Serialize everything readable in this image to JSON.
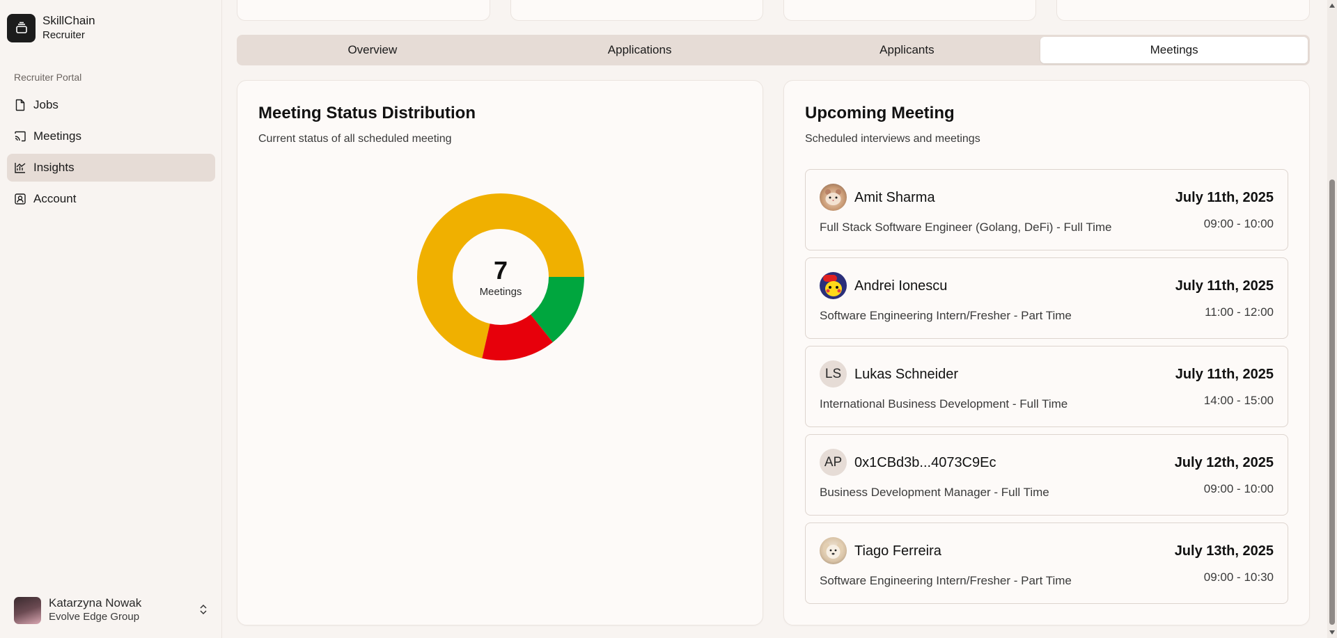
{
  "brand": {
    "name": "SkillChain",
    "subtitle": "Recruiter"
  },
  "sidebar": {
    "section_label": "Recruiter Portal",
    "items": [
      {
        "label": "Jobs",
        "icon": "document-icon"
      },
      {
        "label": "Meetings",
        "icon": "cast-icon"
      },
      {
        "label": "Insights",
        "icon": "chart-icon",
        "active": true
      },
      {
        "label": "Account",
        "icon": "user-square-icon"
      }
    ]
  },
  "user": {
    "name": "Katarzyna Nowak",
    "org": "Evolve Edge Group"
  },
  "tabs": [
    {
      "label": "Overview"
    },
    {
      "label": "Applications"
    },
    {
      "label": "Applicants"
    },
    {
      "label": "Meetings",
      "active": true
    }
  ],
  "status_card": {
    "title": "Meeting Status Distribution",
    "subtitle": "Current status of all scheduled meeting",
    "center_value": "7",
    "center_label": "Meetings"
  },
  "chart_data": {
    "type": "pie",
    "donut": true,
    "total": 7,
    "values": [
      5,
      1,
      1
    ],
    "colors": [
      "#f0b000",
      "#00a63e",
      "#e7000b"
    ]
  },
  "upcoming": {
    "title": "Upcoming Meeting",
    "subtitle": "Scheduled interviews and meetings",
    "meetings": [
      {
        "name": "Amit Sharma",
        "initials": "",
        "avatar": "hamster-photo",
        "date": "July 11th, 2025",
        "time": "09:00 - 10:00",
        "job": "Full Stack Software Engineer (Golang, DeFi) - Full Time"
      },
      {
        "name": "Andrei Ionescu",
        "initials": "",
        "avatar": "pikachu-image",
        "date": "July 11th, 2025",
        "time": "11:00 - 12:00",
        "job": "Software Engineering Intern/Fresher - Part Time"
      },
      {
        "name": "Lukas Schneider",
        "initials": "LS",
        "avatar": "",
        "date": "July 11th, 2025",
        "time": "14:00 - 15:00",
        "job": "International Business Development - Full Time"
      },
      {
        "name": "0x1CBd3b...4073C9Ec",
        "initials": "AP",
        "avatar": "",
        "date": "July 12th, 2025",
        "time": "09:00 - 10:00",
        "job": "Business Development Manager - Full Time"
      },
      {
        "name": "Tiago Ferreira",
        "initials": "",
        "avatar": "dog-photo",
        "date": "July 13th, 2025",
        "time": "09:00 - 10:30",
        "job": "Software Engineering Intern/Fresher - Part Time"
      }
    ]
  }
}
